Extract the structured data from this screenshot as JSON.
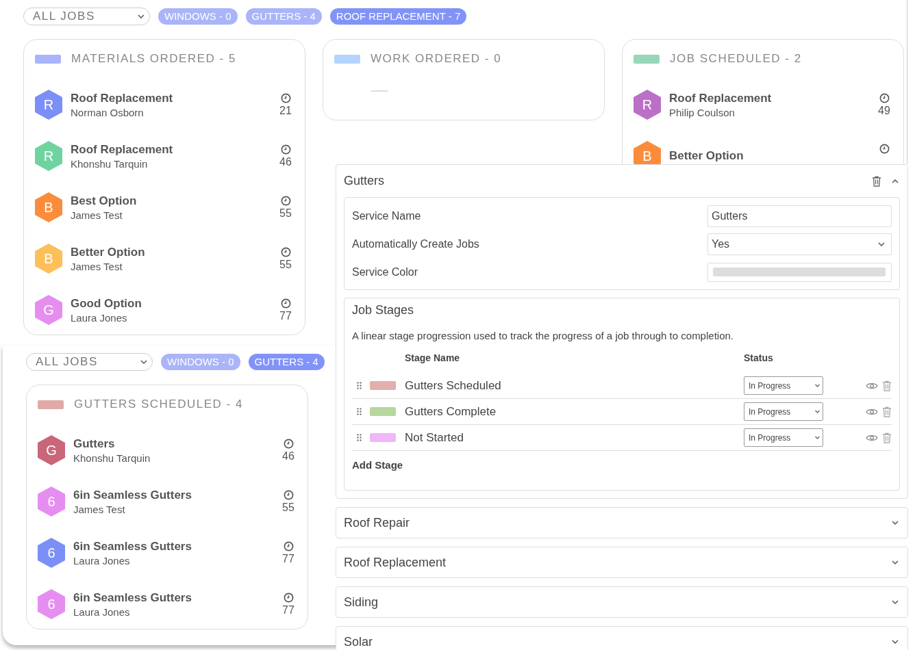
{
  "boards": [
    {
      "filter": {
        "value": "ALL JOBS"
      },
      "pills": [
        {
          "label": "WINDOWS - 0",
          "selected": false
        },
        {
          "label": "GUTTERS - 4",
          "selected": false
        },
        {
          "label": "ROOF REPLACEMENT - 7",
          "selected": true
        }
      ],
      "columns": [
        {
          "title": "MATERIALS ORDERED - 5",
          "color": "#aab4fb",
          "items": [
            {
              "letter": "R",
              "title": "Roof Replacement",
              "customer": "Norman Osborn",
              "count": "21",
              "color": "#7b8ff7"
            },
            {
              "letter": "R",
              "title": "Roof Replacement",
              "customer": "Khonshu Tarquin",
              "count": "46",
              "color": "#6fd3a0"
            },
            {
              "letter": "B",
              "title": "Best Option",
              "customer": "James Test",
              "count": "55",
              "color": "#fb8c3c"
            },
            {
              "letter": "B",
              "title": "Better Option",
              "customer": "James Test",
              "count": "55",
              "color": "#fdbf5a"
            },
            {
              "letter": "G",
              "title": "Good Option",
              "customer": "Laura Jones",
              "count": "77",
              "color": "#e58ef0"
            }
          ]
        },
        {
          "title": "WORK ORDERED - 0",
          "color": "#b3d4fd"
        },
        {
          "title": "JOB SCHEDULED - 2",
          "color": "#98d6b9",
          "items": [
            {
              "letter": "R",
              "title": "Roof Replacement",
              "customer": "Philip Coulson",
              "count": "49",
              "color": "#bb6fc7"
            },
            {
              "letter": "B",
              "title": "Better Option",
              "color": "#fb8c3c"
            }
          ]
        }
      ]
    },
    {
      "filter": {
        "value": "ALL JOBS"
      },
      "pills": [
        {
          "label": "WINDOWS - 0",
          "selected": false
        },
        {
          "label": "GUTTERS - 4",
          "selected": true
        }
      ],
      "columns": [
        {
          "title": "GUTTERS SCHEDULED - 4",
          "color": "#e0aaa8",
          "items": [
            {
              "letter": "G",
              "title": "Gutters",
              "customer": "Khonshu Tarquin",
              "count": "46",
              "color": "#c9667a"
            },
            {
              "letter": "6",
              "title": "6in Seamless Gutters",
              "customer": "James Test",
              "count": "55",
              "color": "#e58ef0"
            },
            {
              "letter": "6",
              "title": "6in Seamless Gutters",
              "customer": "Laura Jones",
              "count": "77",
              "color": "#7b8ff7"
            },
            {
              "letter": "6",
              "title": "6in Seamless Gutters",
              "customer": "Laura Jones",
              "count": "77",
              "color": "#e58ef0"
            }
          ]
        }
      ]
    }
  ],
  "services": [
    {
      "title": "Gutters",
      "expanded": true,
      "fields": [
        {
          "kind": "text",
          "label": "Service Name",
          "value": "Gutters"
        },
        {
          "kind": "select",
          "label": "Automatically Create Jobs",
          "value": "Yes"
        },
        {
          "kind": "color",
          "label": "Service Color"
        }
      ],
      "stages": {
        "title": "Job Stages",
        "description": "A linear stage progression used to track the progress of a job through to completion.",
        "columns": [
          "Stage Name",
          "Status"
        ],
        "rows": [
          {
            "name": "Gutters Scheduled",
            "color": "#e5adad",
            "status": "In Progress"
          },
          {
            "name": "Gutters Complete",
            "color": "#b6d79d",
            "status": "In Progress"
          },
          {
            "name": "Not Started",
            "color": "#efb6f8",
            "status": "In Progress"
          }
        ],
        "add": "Add Stage"
      }
    },
    {
      "title": "Roof Repair",
      "expanded": false
    },
    {
      "title": "Roof Replacement",
      "expanded": false
    },
    {
      "title": "Siding",
      "expanded": false
    },
    {
      "title": "Solar",
      "expanded": false
    }
  ]
}
